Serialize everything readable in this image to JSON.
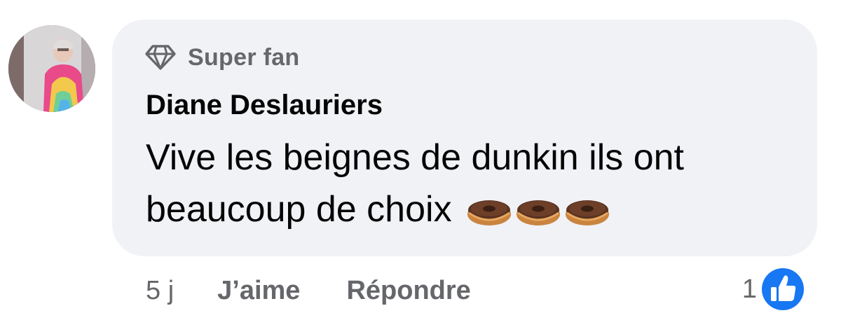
{
  "comment": {
    "badge": {
      "icon": "diamond-icon",
      "label": "Super fan"
    },
    "author": "Diane Deslauriers",
    "text": "Vive les beignes de dunkin ils ont beaucoup de choix",
    "emojis": [
      "doughnut",
      "doughnut",
      "doughnut"
    ],
    "time": "5 j",
    "actions": {
      "like": "J’aime",
      "reply": "Répondre"
    },
    "reactions": {
      "count": "1",
      "icon": "thumbs-up-icon"
    }
  },
  "colors": {
    "bubble_bg": "#f0f2f5",
    "secondary_text": "#65676b",
    "primary_text": "#050505",
    "like_blue": "#1877f2"
  }
}
